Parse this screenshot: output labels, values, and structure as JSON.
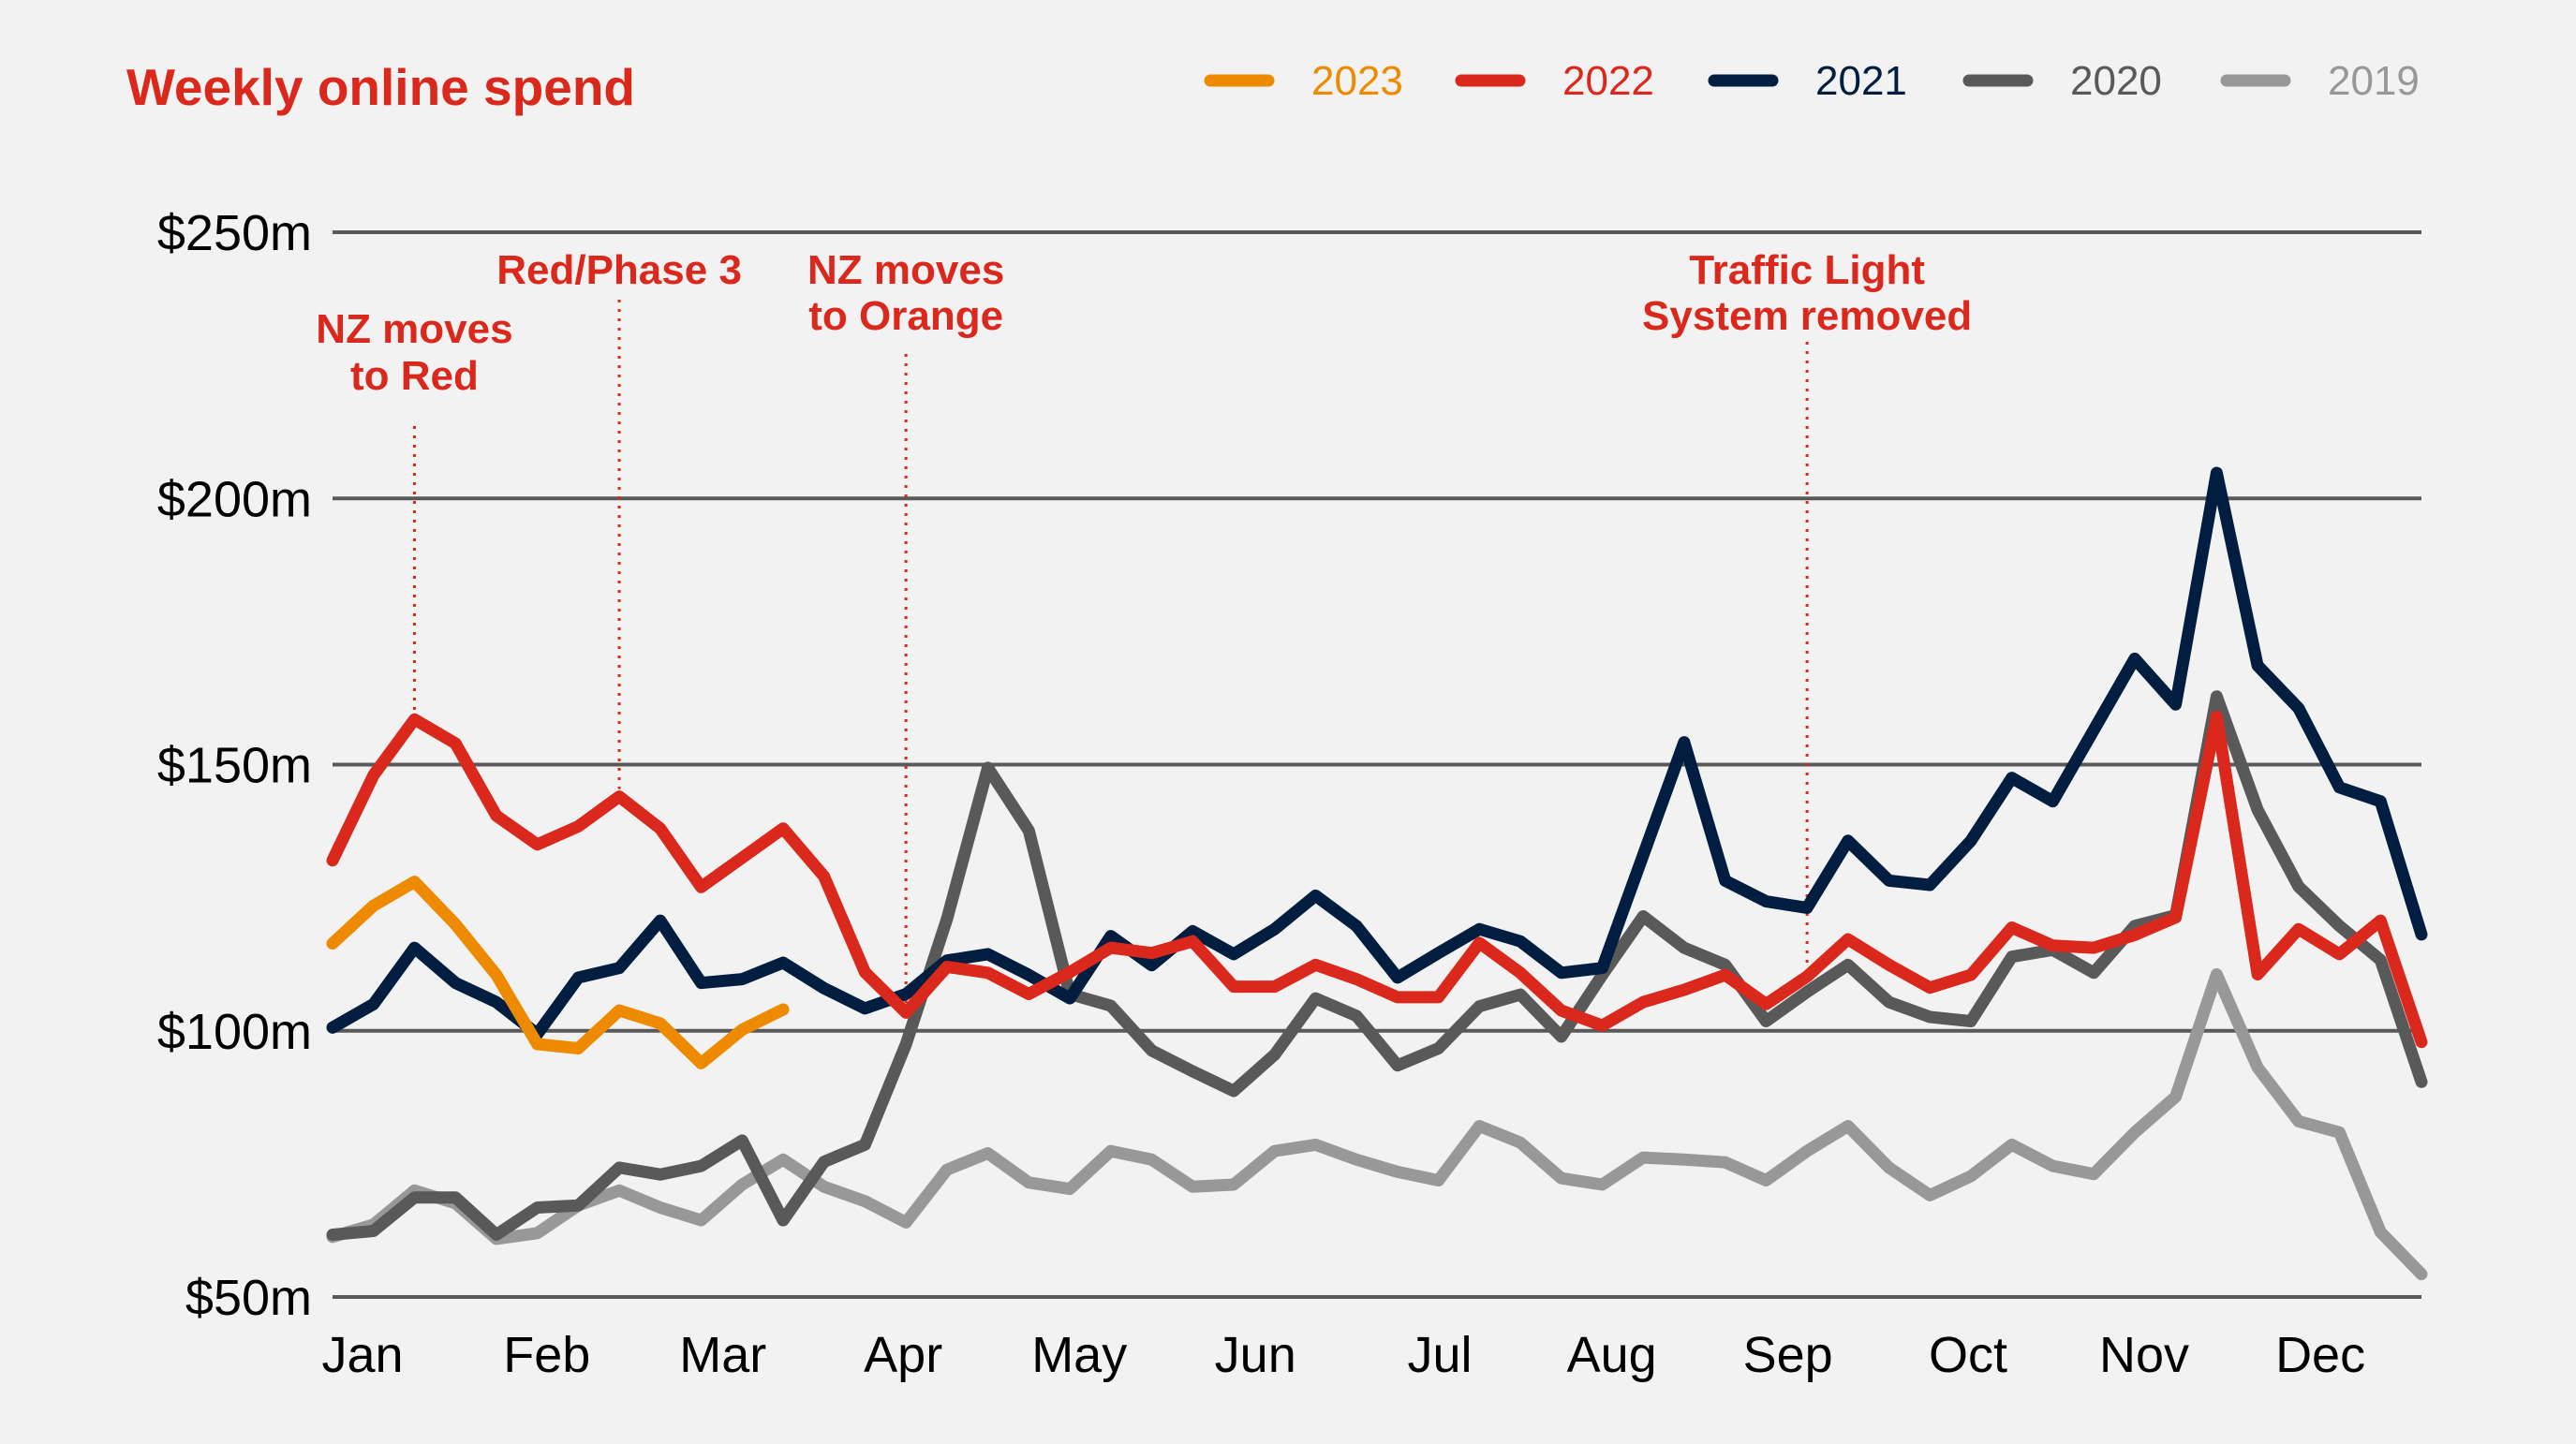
{
  "chart_data": {
    "type": "line",
    "title": "Weekly online spend",
    "xlabel": "",
    "ylabel": "",
    "ylim": [
      50,
      250
    ],
    "yticks": [
      {
        "value": 250,
        "label": "$250m"
      },
      {
        "value": 200,
        "label": "$200m"
      },
      {
        "value": 150,
        "label": "$150m"
      },
      {
        "value": 100,
        "label": "$100m"
      },
      {
        "value": 50,
        "label": "$50m"
      }
    ],
    "x_unit": "week of year",
    "x_range": [
      1,
      52
    ],
    "xticks": [
      {
        "week": 1,
        "label": "Jan"
      },
      {
        "week": 5.5,
        "label": "Feb"
      },
      {
        "week": 9.8,
        "label": "Mar"
      },
      {
        "week": 14.2,
        "label": "Apr"
      },
      {
        "week": 18.5,
        "label": "May"
      },
      {
        "week": 22.8,
        "label": "Jun"
      },
      {
        "week": 27.3,
        "label": "Jul"
      },
      {
        "week": 31.5,
        "label": "Aug"
      },
      {
        "week": 35.8,
        "label": "Sep"
      },
      {
        "week": 40.2,
        "label": "Oct"
      },
      {
        "week": 44.5,
        "label": "Nov"
      },
      {
        "week": 48.8,
        "label": "Dec"
      }
    ],
    "grid": true,
    "legend_position": "top-right",
    "series": [
      {
        "name": "2019",
        "color": "#989898",
        "values": [
          61.3,
          63.6,
          70,
          67.6,
          60.9,
          62,
          67.2,
          70,
          66.8,
          64.4,
          71.1,
          75.8,
          70.7,
          68,
          64,
          73.9,
          77,
          71.5,
          70.3,
          77.4,
          75.8,
          70.7,
          71.1,
          77.4,
          78.6,
          75.8,
          73.5,
          71.9,
          82.1,
          79,
          72.3,
          71.1,
          76.2,
          75.8,
          75.3,
          71.9,
          77.4,
          82.1,
          74.3,
          69.1,
          72.7,
          78.6,
          74.6,
          73.1,
          80.9,
          87.6,
          110.6,
          93.1,
          83,
          80.9,
          62.2,
          54.3
        ]
      },
      {
        "name": "2020",
        "color": "#595959",
        "values": [
          61.7,
          62.4,
          68.7,
          68.7,
          61.7,
          66.8,
          67.2,
          74.3,
          73,
          74.6,
          79.4,
          64.4,
          75.4,
          78.6,
          97.5,
          121,
          149.4,
          137.6,
          106.9,
          104.7,
          96.3,
          92.4,
          88.7,
          95.5,
          106.1,
          102.8,
          93.5,
          96.7,
          104.6,
          106.8,
          98.9,
          110.5,
          121.5,
          115.6,
          112.4,
          101.8,
          107.3,
          112.4,
          105.4,
          102.6,
          101.8,
          113.9,
          115.2,
          110.9,
          119.7,
          121.7,
          162.8,
          141.5,
          127.1,
          119.7,
          113.3,
          90.4
        ]
      },
      {
        "name": "2021",
        "color": "#011e41",
        "values": [
          100.6,
          105,
          115.6,
          109,
          105.4,
          99.4,
          110,
          111.8,
          120.7,
          109,
          109.7,
          112.8,
          108,
          104.2,
          106.9,
          113.2,
          114.4,
          110.5,
          106.1,
          117.8,
          112.3,
          118.7,
          114.4,
          119.1,
          125.4,
          119.7,
          110,
          114.6,
          119.1,
          116.8,
          110.9,
          111.8,
          133,
          154.2,
          128.2,
          124.3,
          123.1,
          135.7,
          128.2,
          127.4,
          135.7,
          147.5,
          143.1,
          156.5,
          169.9,
          161.3,
          204.8,
          168.6,
          160.6,
          145.7,
          143.1,
          118.1
        ]
      },
      {
        "name": "2022",
        "color": "#da291c",
        "values": [
          132,
          148,
          158.5,
          154,
          140.4,
          135,
          138.4,
          144,
          138,
          127,
          132.5,
          138,
          129,
          111,
          103.4,
          112,
          110.9,
          106.9,
          111,
          115.6,
          114.6,
          116.8,
          108.3,
          108.3,
          112.4,
          109.7,
          106.3,
          106.3,
          116.5,
          110.9,
          103.8,
          101,
          105.4,
          107.7,
          110.5,
          105,
          110.2,
          117.2,
          112.4,
          108.1,
          110.5,
          119.4,
          116,
          115.6,
          118,
          121.3,
          159,
          110.6,
          119.1,
          114.4,
          120.7,
          97.9
        ]
      },
      {
        "name": "2023",
        "color": "#ee8a00",
        "values": [
          116.4,
          123.5,
          128,
          120,
          110.5,
          97.5,
          96.7,
          103.8,
          101.4,
          93.9,
          100.2,
          104
        ]
      }
    ],
    "legend_order": [
      "2023",
      "2022",
      "2021",
      "2020",
      "2019"
    ],
    "annotations": [
      {
        "lines": [
          "NZ moves",
          "to Red"
        ],
        "week": 3
      },
      {
        "lines": [
          "Red/Phase 3"
        ],
        "week": 8
      },
      {
        "lines": [
          "NZ moves",
          "to Orange"
        ],
        "week": 15
      },
      {
        "lines": [
          "Traffic Light",
          "System removed"
        ],
        "week": 37
      }
    ]
  },
  "colors": {
    "background": "#f2f2f2",
    "grid": "#595959",
    "title": "#da291c",
    "annotation": "#da291c"
  }
}
